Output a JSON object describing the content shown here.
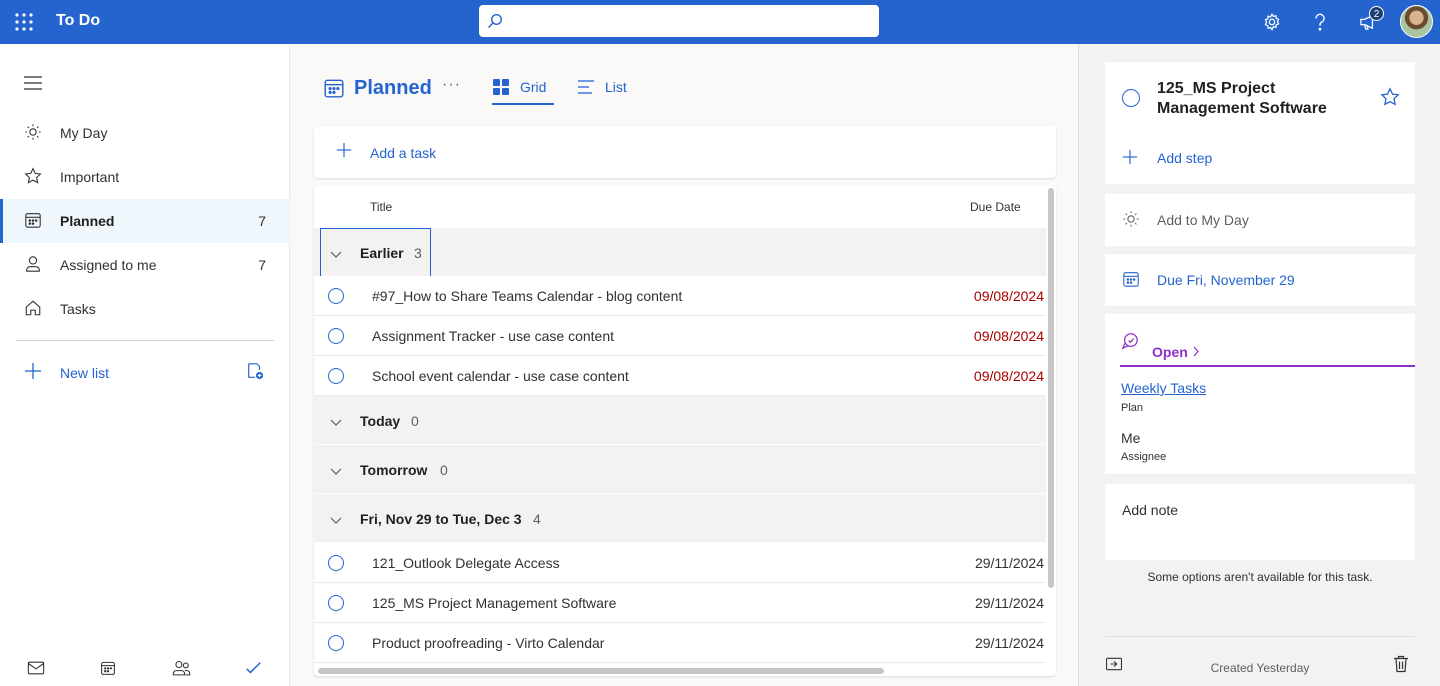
{
  "header": {
    "app_title": "To Do",
    "search_placeholder": "",
    "notifications_count": "2",
    "brand_color": "#2564cf"
  },
  "sidebar": {
    "items": [
      {
        "label": "My Day",
        "count": "",
        "icon": "sun-icon"
      },
      {
        "label": "Important",
        "count": "",
        "icon": "star-icon"
      },
      {
        "label": "Planned",
        "count": "7",
        "icon": "calendar-icon",
        "active": true
      },
      {
        "label": "Assigned to me",
        "count": "7",
        "icon": "person-icon"
      },
      {
        "label": "Tasks",
        "count": "",
        "icon": "home-icon"
      }
    ],
    "new_list_label": "New list",
    "bottom_apps": [
      "mail-icon",
      "calendar-icon",
      "people-icon",
      "todo-check-icon"
    ]
  },
  "main": {
    "title": "Planned",
    "more_label": "···",
    "views": [
      {
        "label": "Grid",
        "active": true
      },
      {
        "label": "List",
        "active": false
      }
    ],
    "add_task_label": "Add a task",
    "columns": {
      "title": "Title",
      "due": "Due Date"
    },
    "groups": [
      {
        "label": "Earlier",
        "count": "3",
        "tasks": [
          {
            "title": "#97_How to Share Teams Calendar - blog content",
            "due": "09/08/2024",
            "overdue": true
          },
          {
            "title": "Assignment Tracker - use case content",
            "due": "09/08/2024",
            "overdue": true
          },
          {
            "title": "School event calendar - use case content",
            "due": "09/08/2024",
            "overdue": true
          }
        ]
      },
      {
        "label": "Today",
        "count": "0",
        "tasks": []
      },
      {
        "label": "Tomorrow",
        "count": "0",
        "tasks": []
      },
      {
        "label": "Fri, Nov 29 to Tue, Dec 3",
        "count": "4",
        "tasks": [
          {
            "title": "121_Outlook Delegate Access",
            "due": "29/11/2024",
            "overdue": false
          },
          {
            "title": "125_MS Project Management Software",
            "due": "29/11/2024",
            "overdue": false
          },
          {
            "title": "Product proofreading - Virto Calendar",
            "due": "29/11/2024",
            "overdue": false
          }
        ]
      }
    ],
    "overdue_color": "#a80000"
  },
  "details": {
    "task_title": "125_MS Project Management Software",
    "add_step_label": "Add step",
    "add_to_my_day_label": "Add to My Day",
    "due_label": "Due Fri, November 29",
    "open_label": "Open",
    "plan_name": "Weekly Tasks",
    "plan_caption": "Plan",
    "assignee_name": "Me",
    "assignee_caption": "Assignee",
    "note_placeholder": "Add note",
    "options_notice": "Some options aren't available for this task.",
    "created_label": "Created Yesterday",
    "planner_color": "#8e30c9"
  }
}
